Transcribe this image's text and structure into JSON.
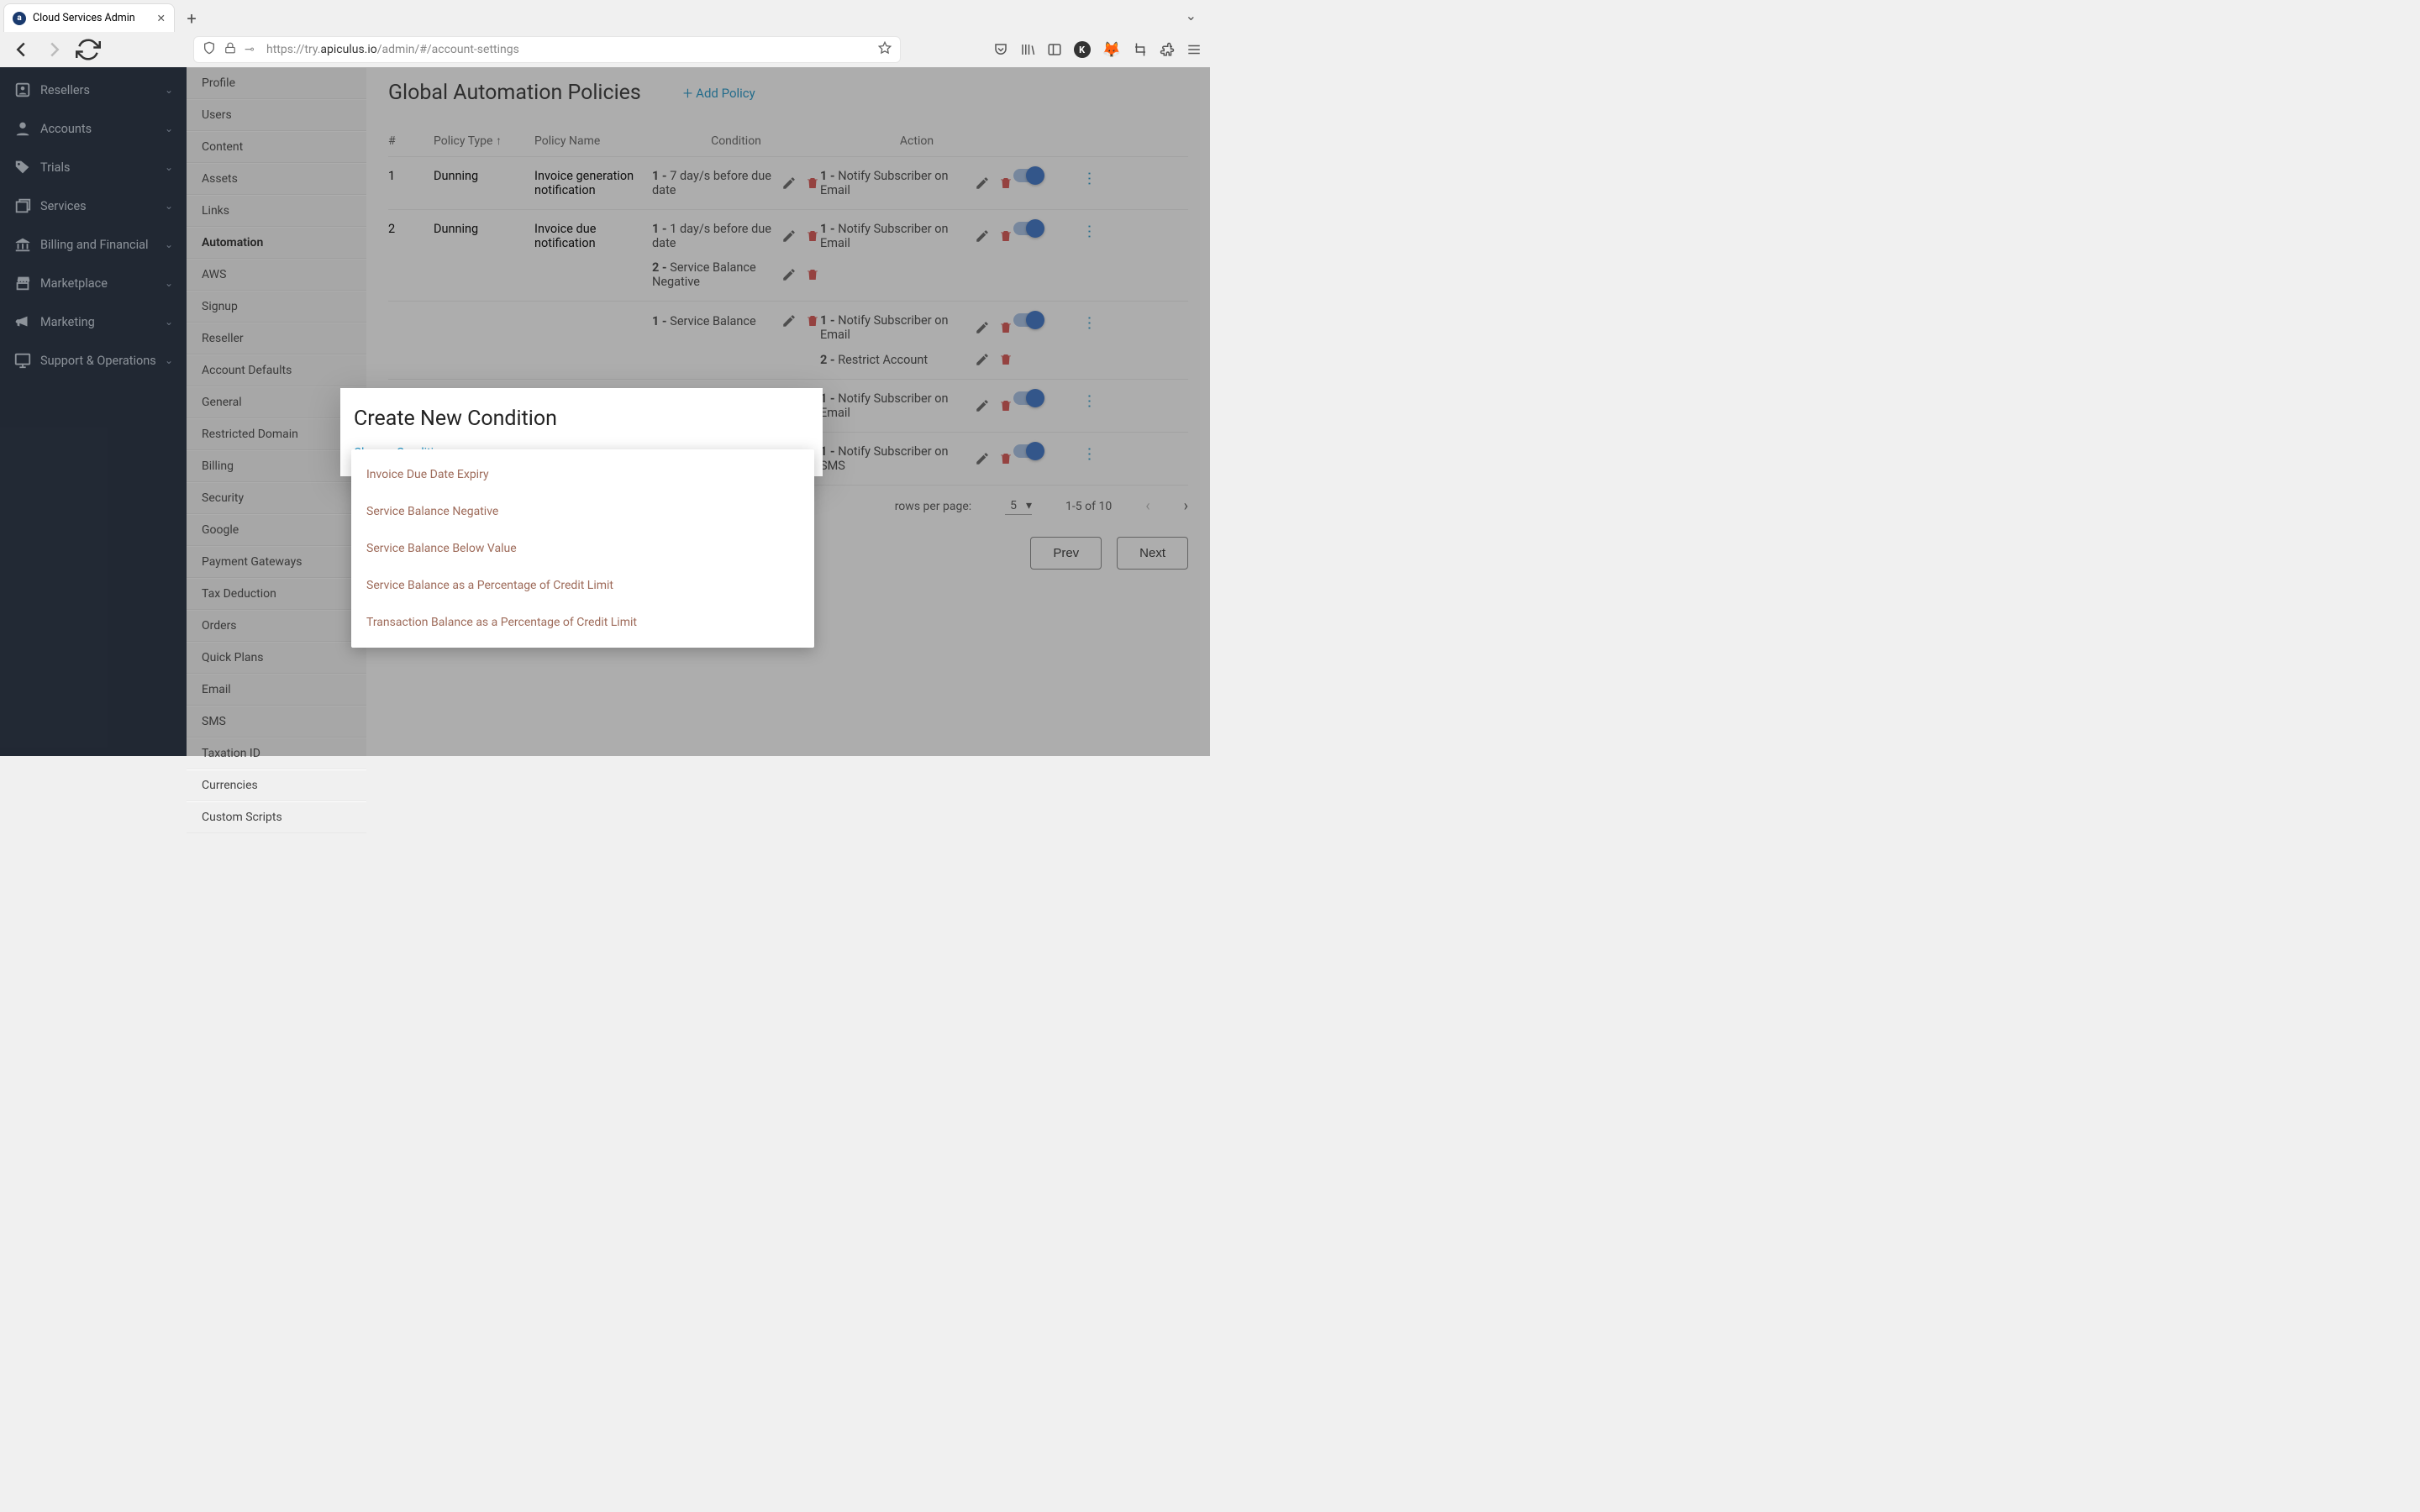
{
  "browser": {
    "tab_title": "Cloud Services Admin",
    "url_display_prefix": "https://try.",
    "url_display_host": "apiculus.io",
    "url_display_path": "/admin/#/account-settings"
  },
  "sidebar": {
    "items": [
      {
        "label": "Resellers",
        "icon": "user"
      },
      {
        "label": "Accounts",
        "icon": "person"
      },
      {
        "label": "Trials",
        "icon": "tag"
      },
      {
        "label": "Services",
        "icon": "layers"
      },
      {
        "label": "Billing and Financial",
        "icon": "bank"
      },
      {
        "label": "Marketplace",
        "icon": "store"
      },
      {
        "label": "Marketing",
        "icon": "megaphone"
      },
      {
        "label": "Support & Operations",
        "icon": "monitor"
      }
    ]
  },
  "sub_sidebar": {
    "items": [
      "Profile",
      "Users",
      "Content",
      "Assets",
      "Links",
      "Automation",
      "AWS",
      "Signup",
      "Reseller",
      "Account Defaults",
      "General",
      "Restricted Domain",
      "Billing",
      "Security",
      "Google",
      "Payment Gateways",
      "Tax Deduction",
      "Orders",
      "Quick Plans",
      "Email",
      "SMS",
      "Taxation ID",
      "Currencies",
      "Custom Scripts"
    ],
    "active": "Automation"
  },
  "page": {
    "title": "Global Automation Policies",
    "add_policy": "Add Policy"
  },
  "table": {
    "headers": {
      "num": "#",
      "type": "Policy Type",
      "name": "Policy Name",
      "cond": "Condition",
      "act": "Action"
    },
    "rows": [
      {
        "n": "1",
        "type": "Dunning",
        "name": "Invoice generation notification",
        "conditions": [
          {
            "n": "1",
            "t": "7 day/s before due date"
          }
        ],
        "actions": [
          {
            "n": "1",
            "t": "Notify Subscriber on Email"
          }
        ]
      },
      {
        "n": "2",
        "type": "Dunning",
        "name": "Invoice due notification",
        "conditions": [
          {
            "n": "1",
            "t": "1 day/s before due date"
          },
          {
            "n": "2",
            "t": "Service Balance Negative"
          }
        ],
        "actions": [
          {
            "n": "1",
            "t": "Notify Subscriber on Email"
          }
        ]
      },
      {
        "n": "",
        "type": "",
        "name": "",
        "conditions": [
          {
            "n": "1",
            "t": "Service Balance"
          }
        ],
        "actions": [
          {
            "n": "1",
            "t": "Notify Subscriber on Email"
          },
          {
            "n": "2",
            "t": "Restrict Account"
          }
        ]
      },
      {
        "n": "",
        "type": "",
        "name": "",
        "conditions": [],
        "actions": [
          {
            "n": "1",
            "t": "Notify Subscriber on Email"
          }
        ]
      },
      {
        "n": "",
        "type": "",
        "name": "",
        "conditions": [],
        "actions": [
          {
            "n": "1",
            "t": "Notify Subscriber on SMS"
          }
        ]
      }
    ]
  },
  "pagination": {
    "rpp_label": "rows per page:",
    "rpp_value": "5",
    "range": "1-5 of 10",
    "prev": "Prev",
    "next": "Next"
  },
  "modal": {
    "title": "Create New Condition",
    "field_label": "Choose Condition",
    "options": [
      "Invoice Due Date Expiry",
      "Service Balance Negative",
      "Service Balance Below Value",
      "Service Balance as a Percentage of Credit Limit",
      "Transaction Balance as a Percentage of Credit Limit"
    ]
  }
}
